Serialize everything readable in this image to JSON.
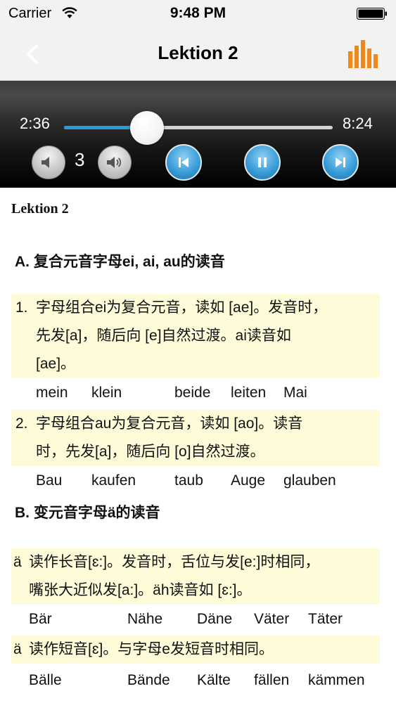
{
  "status_bar": {
    "carrier": "Carrier",
    "time": "9:48 PM"
  },
  "nav": {
    "title": "Lektion 2"
  },
  "player": {
    "current_time": "2:36",
    "total_time": "8:24",
    "progress": 0.31,
    "volume": "3",
    "accent_color": "#2b9ad6"
  },
  "content": {
    "doc_title": "Lektion 2",
    "section_a": {
      "heading": "A. 复合元音字母ei, ai, au的读音",
      "items": [
        {
          "number": "1.",
          "lines": [
            "字母组合ei为复合元音，读如 [ae]。发音时，",
            "先发[a]，随后向 [e]自然过渡。ai读音如",
            "[ae]。"
          ],
          "words": [
            "mein",
            "klein",
            "beide",
            "leiten",
            "Mai"
          ]
        },
        {
          "number": "2.",
          "lines": [
            "字母组合au为复合元音，读如 [ao]。读音",
            "时，先发[a]，随后向 [o]自然过渡。"
          ],
          "words": [
            "Bau",
            "kaufen",
            "taub",
            "Auge",
            "glauben"
          ]
        }
      ]
    },
    "section_b": {
      "heading": "B. 变元音字母ä的读音",
      "items": [
        {
          "number": "ä",
          "lines": [
            "读作长音[ɛ:]。发音时，舌位与发[e:]时相同，",
            "嘴张大近似发[a:]。äh读音如 [ɛ:]。"
          ],
          "words": [
            "Bär",
            "Nähe",
            "Däne",
            "Väter",
            "Täter"
          ]
        },
        {
          "number": "ä",
          "lines": [
            "读作短音[ɛ]。与字母e发短音时相同。"
          ],
          "words": [
            "Bälle",
            "Bände",
            "Kälte",
            "fällen",
            "kämmen"
          ]
        }
      ]
    },
    "highlight_color": "#fdfbd8"
  }
}
